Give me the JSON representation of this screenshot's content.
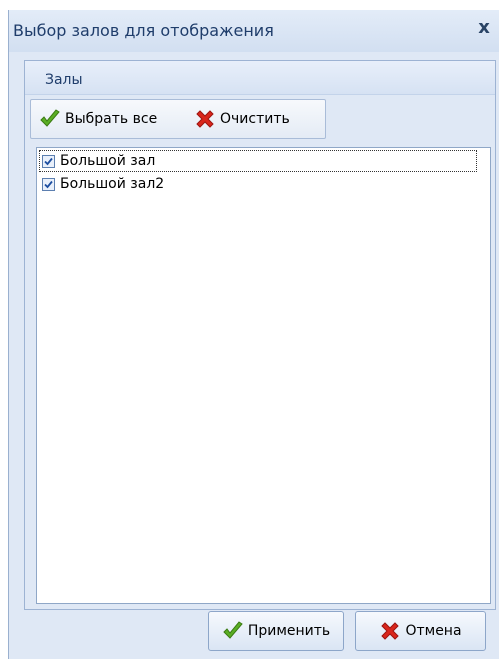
{
  "window": {
    "title": "Выбор залов для отображения",
    "close_label": "x"
  },
  "group": {
    "title": "Залы"
  },
  "toolbar": {
    "select_all_label": "Выбрать все",
    "clear_label": "Очистить"
  },
  "halls": [
    {
      "label": "Большой зал",
      "checked": true
    },
    {
      "label": "Большой зал2",
      "checked": true
    }
  ],
  "footer": {
    "apply_label": "Применить",
    "cancel_label": "Отмена"
  },
  "colors": {
    "accent": "#4b9a1e",
    "danger": "#d41919",
    "title_text": "#1f3d6b",
    "frame": "#dfe8f5"
  }
}
